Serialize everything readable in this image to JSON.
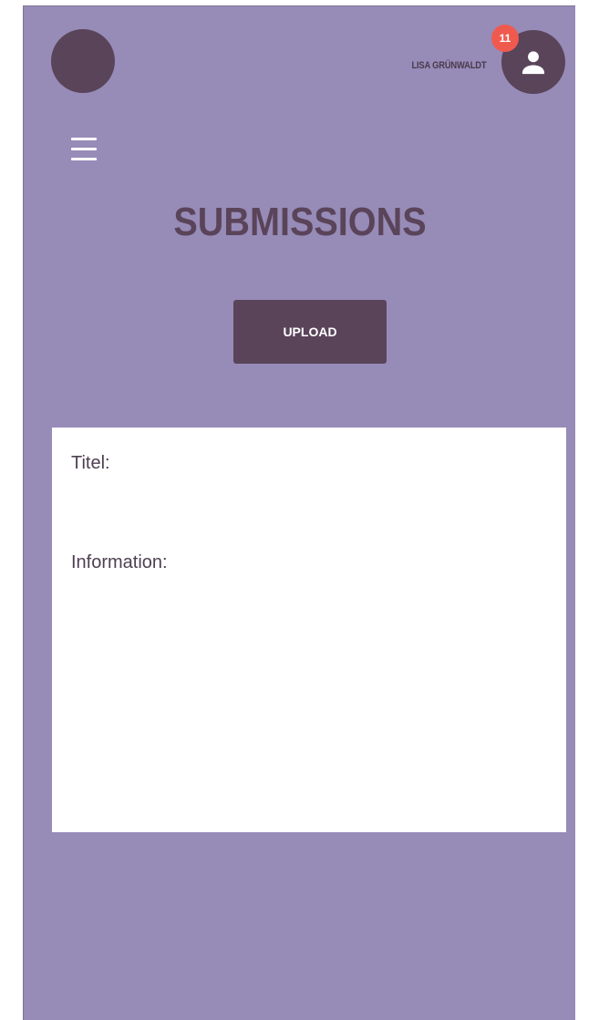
{
  "header": {
    "user_name": "LISA GRÜNWALDT",
    "notification_count": "11",
    "avatar_icon": "person-icon",
    "menu_icon": "hamburger-menu-icon"
  },
  "page": {
    "title": "SUBMISSIONS",
    "upload_label": "UPLOAD"
  },
  "card": {
    "title_label": "Titel:",
    "information_label": "Information:"
  },
  "colors": {
    "background": "#978bb8",
    "primary_dark": "#5a4459",
    "badge": "#f05a4e",
    "card": "#ffffff"
  }
}
